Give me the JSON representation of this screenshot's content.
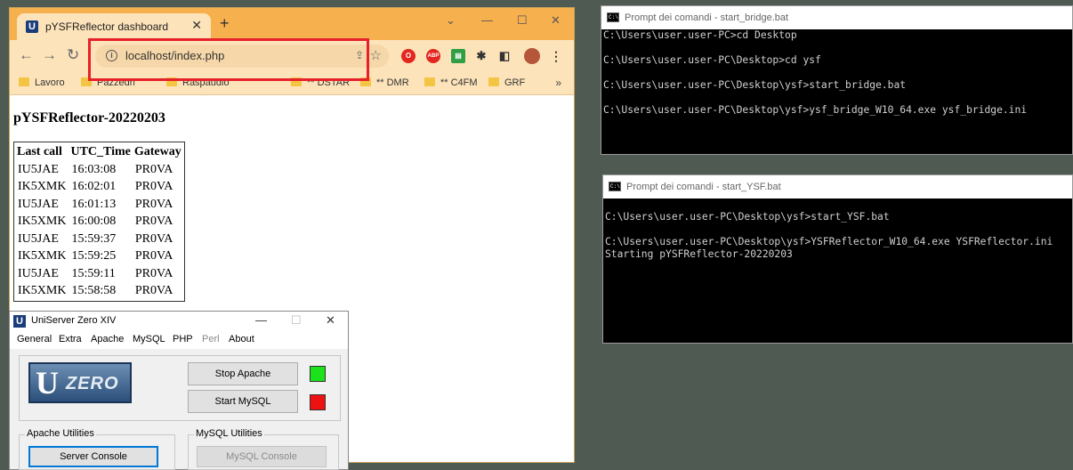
{
  "browser": {
    "tab_title": "pYSFReflector dashboard",
    "favicon_letter": "U",
    "new_tab_symbol": "+",
    "url": "localhost/index.php",
    "bookmarks": [
      "Lavoro",
      "Pazzedri",
      "Raspaudio",
      "** DSTAR",
      "** DMR",
      "** C4FM",
      "GRF"
    ],
    "bookmarks_more": "»",
    "highlight_color": "#e8202a",
    "icons": [
      "back-icon",
      "forward-icon",
      "reload-icon",
      "info-icon",
      "share-icon",
      "star-icon",
      "extensions-icon",
      "sidebar-icon",
      "profile-icon",
      "menu-icon"
    ]
  },
  "dashboard": {
    "title": "pYSFReflector-20220203",
    "columns": [
      "Last call",
      "UTC_Time",
      "Gateway"
    ],
    "rows": [
      [
        "IU5JAE",
        "16:03:08",
        "PR0VA"
      ],
      [
        "IK5XMK",
        "16:02:01",
        "PR0VA"
      ],
      [
        "IU5JAE",
        "16:01:13",
        "PR0VA"
      ],
      [
        "IK5XMK",
        "16:00:08",
        "PR0VA"
      ],
      [
        "IU5JAE",
        "15:59:37",
        "PR0VA"
      ],
      [
        "IK5XMK",
        "15:59:25",
        "PR0VA"
      ],
      [
        "IU5JAE",
        "15:59:11",
        "PR0VA"
      ],
      [
        "IK5XMK",
        "15:58:58",
        "PR0VA"
      ]
    ]
  },
  "uniserver": {
    "title": "UniServer Zero XIV",
    "icon_letter": "U",
    "menu": [
      "General",
      "Extra",
      "Apache",
      "MySQL",
      "PHP",
      "Perl",
      "About"
    ],
    "logo_u": "U",
    "logo_text": "ZERO",
    "stop_apache": "Stop Apache",
    "start_mysql": "Start MySQL",
    "apache_status_color": "#1be21b",
    "mysql_status_color": "#ee1111",
    "apache_group": "Apache Utilities",
    "mysql_group": "MySQL Utilities",
    "server_console": "Server Console",
    "mysql_console": "MySQL Console"
  },
  "console1": {
    "title": "Prompt dei comandi - start_bridge.bat",
    "text": "C:\\Users\\user.user-PC>cd Desktop\n\nC:\\Users\\user.user-PC\\Desktop>cd ysf\n\nC:\\Users\\user.user-PC\\Desktop\\ysf>start_bridge.bat\n\nC:\\Users\\user.user-PC\\Desktop\\ysf>ysf_bridge_W10_64.exe ysf_bridge.ini"
  },
  "console2": {
    "title": "Prompt dei comandi - start_YSF.bat",
    "text": "\nC:\\Users\\user.user-PC\\Desktop\\ysf>start_YSF.bat\n\nC:\\Users\\user.user-PC\\Desktop\\ysf>YSFReflector_W10_64.exe YSFReflector.ini\nStarting pYSFReflector-20220203"
  }
}
